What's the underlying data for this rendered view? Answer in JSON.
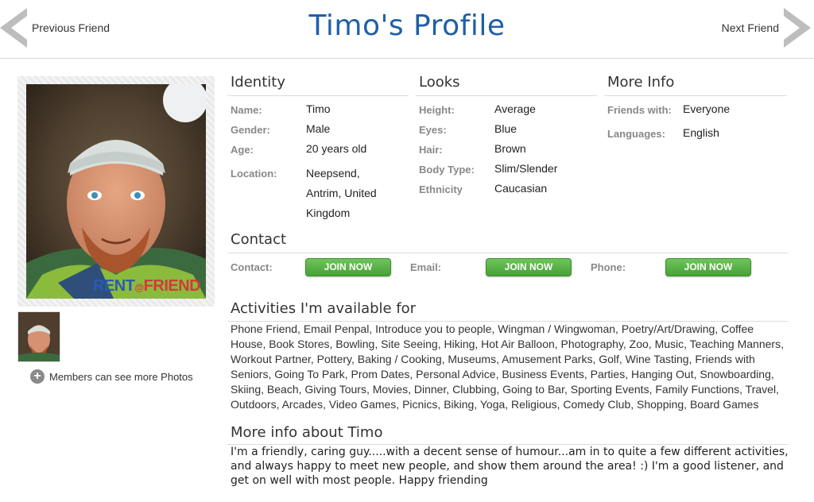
{
  "header": {
    "title": "Timo's Profile",
    "prev_label": "Previous Friend",
    "next_label": "Next Friend"
  },
  "photo": {
    "watermark": "RENT a FRIEND",
    "more_photos_label": "Members can see more Photos"
  },
  "identity": {
    "title": "Identity",
    "name_label": "Name:",
    "name": "Timo",
    "gender_label": "Gender:",
    "gender": "Male",
    "age_label": "Age:",
    "age": "20 years old",
    "location_label": "Location:",
    "location_line1": "Neepsend,",
    "location_line2": "Antrim, United",
    "location_line3": "Kingdom"
  },
  "looks": {
    "title": "Looks",
    "height_label": "Height:",
    "height": "Average",
    "eyes_label": "Eyes:",
    "eyes": "Blue",
    "hair_label": "Hair:",
    "hair": "Brown",
    "body_label": "Body Type:",
    "body": "Slim/Slender",
    "ethnicity_label": "Ethnicity",
    "ethnicity": "Caucasian"
  },
  "more_info": {
    "title": "More Info",
    "friends_label": "Friends with:",
    "friends": "Everyone",
    "languages_label": "Languages:",
    "languages": "English"
  },
  "contact": {
    "title": "Contact",
    "contact_label": "Contact:",
    "email_label": "Email:",
    "phone_label": "Phone:",
    "join_label": "JOIN NOW"
  },
  "activities": {
    "title": "Activities I'm available for",
    "text": "Phone Friend, Email Penpal, Introduce you to people, Wingman / Wingwoman, Poetry/Art/Drawing, Coffee House, Book Stores, Bowling, Site Seeing, Hiking, Hot Air Balloon, Photography, Zoo, Music, Teaching Manners, Workout Partner, Pottery, Baking / Cooking, Museums, Amusement Parks, Golf, Wine Tasting, Friends with Seniors, Going To Park, Prom Dates, Personal Advice, Business Events, Parties, Hanging Out, Snowboarding, Skiing, Beach, Giving Tours, Movies, Dinner, Clubbing, Going to Bar, Sporting Events, Family Functions, Travel, Outdoors, Arcades, Video Games, Picnics, Biking, Yoga, Religious, Comedy Club, Shopping, Board Games"
  },
  "about": {
    "title": "More info about Timo",
    "text": "I'm a friendly, caring guy.....with a decent sense of humour...am in to quite a few different activities, and always happy to meet new people, and show them around the area! :) I'm a good listener, and get on well with most people. Happy friending"
  },
  "colors": {
    "title_blue": "#1f5fa8",
    "join_green": "#4caf3c"
  }
}
